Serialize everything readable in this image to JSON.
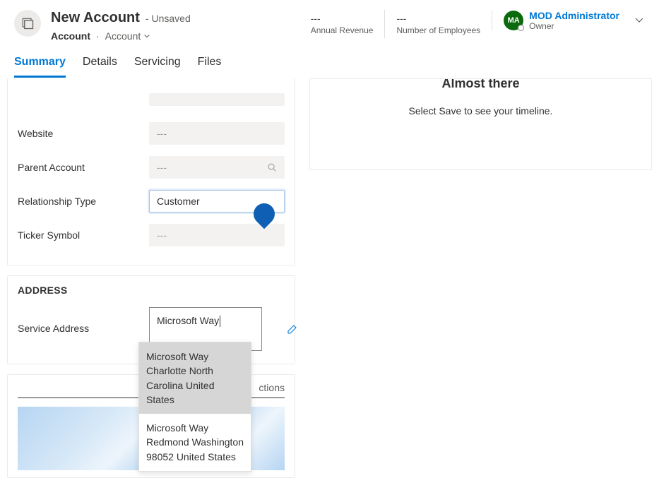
{
  "header": {
    "title": "New Account",
    "unsaved_suffix": "- Unsaved",
    "breadcrumb_entity": "Account",
    "breadcrumb_form": "Account",
    "fields": {
      "annual_revenue": {
        "value": "---",
        "label": "Annual Revenue"
      },
      "num_employees": {
        "value": "---",
        "label": "Number of Employees"
      }
    },
    "owner": {
      "initials": "MA",
      "name": "MOD Administrator",
      "role": "Owner"
    }
  },
  "tabs": [
    "Summary",
    "Details",
    "Servicing",
    "Files"
  ],
  "active_tab": "Summary",
  "form": {
    "website": {
      "label": "Website",
      "value": "---"
    },
    "parent_account": {
      "label": "Parent Account",
      "value": "---"
    },
    "relationship_type": {
      "label": "Relationship Type",
      "value": "Customer"
    },
    "ticker_symbol": {
      "label": "Ticker Symbol",
      "value": "---"
    }
  },
  "address_section": {
    "heading": "ADDRESS",
    "service_address_label": "Service Address",
    "service_address_value": "Microsoft Way"
  },
  "autocomplete": {
    "items": [
      "Microsoft Way Charlotte North Carolina United States",
      "Microsoft Way Redmond Washington 98052 United States"
    ]
  },
  "map_section": {
    "heading_right": "ctions"
  },
  "right_panel": {
    "title": "Almost there",
    "subtitle": "Select Save to see your timeline."
  }
}
